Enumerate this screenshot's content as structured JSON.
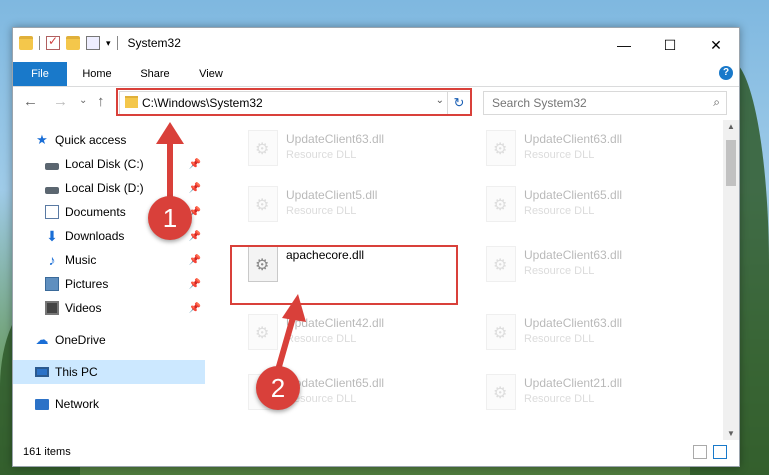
{
  "window": {
    "title": "System32",
    "controls": {
      "minimize": "—",
      "maximize": "☐",
      "close": "✕"
    }
  },
  "ribbon": {
    "tabs": [
      "File",
      "Home",
      "Share",
      "View"
    ],
    "help": "?"
  },
  "nav": {
    "back": "←",
    "forward": "→",
    "recent": "⌄",
    "up": "↑",
    "address": "C:\\Windows\\System32",
    "search_placeholder": "Search System32"
  },
  "sidebar": {
    "items": [
      {
        "label": "Quick access"
      },
      {
        "label": "Local Disk (C:)"
      },
      {
        "label": "Local Disk (D:)"
      },
      {
        "label": "Documents"
      },
      {
        "label": "Downloads"
      },
      {
        "label": "Music"
      },
      {
        "label": "Pictures"
      },
      {
        "label": "Videos"
      },
      {
        "label": "OneDrive"
      },
      {
        "label": "This PC"
      },
      {
        "label": "Network"
      }
    ]
  },
  "files": [
    {
      "name": "UpdateClient63.dll",
      "type": "Resource DLL"
    },
    {
      "name": "UpdateClient63.dll",
      "type": "Resource DLL"
    },
    {
      "name": "UpdateClient5.dll",
      "type": "Resource DLL"
    },
    {
      "name": "UpdateClient65.dll",
      "type": "Resource DLL"
    },
    {
      "name": "apachecore.dll",
      "type": ""
    },
    {
      "name": "UpdateClient63.dll",
      "type": "Resource DLL"
    },
    {
      "name": "UpdateClient42.dll",
      "type": "Resource DLL"
    },
    {
      "name": "UpdateClient63.dll",
      "type": "Resource DLL"
    },
    {
      "name": "UpdateClient65.dll",
      "type": "Resource DLL"
    },
    {
      "name": "UpdateClient21.dll",
      "type": "Resource DLL"
    }
  ],
  "status": {
    "count": "161 items"
  },
  "markers": {
    "one": "1",
    "two": "2"
  },
  "colors": {
    "accent": "#1979ca",
    "highlight": "#d9403a",
    "selected": "#cce8ff"
  }
}
